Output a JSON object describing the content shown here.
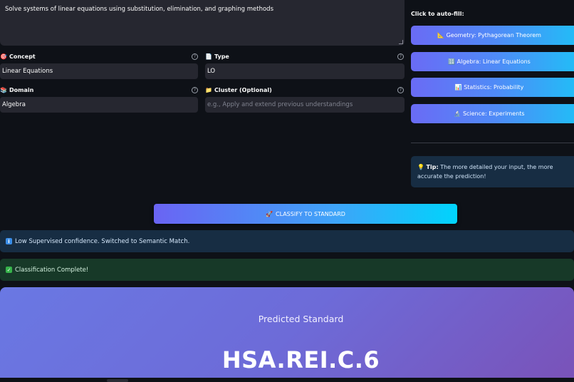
{
  "description_input": {
    "value": "Solve systems of linear equations using substitution, elimination, and graphing methods"
  },
  "fields": {
    "concept": {
      "icon": "concept-icon",
      "label": "Concept",
      "value": "Linear Equations"
    },
    "type": {
      "icon": "type-icon",
      "label": "Type",
      "value": "LO"
    },
    "domain": {
      "icon": "domain-icon",
      "label": "Domain",
      "value": "Algebra"
    },
    "cluster": {
      "icon": "folder-icon",
      "label": "Cluster (Optional)",
      "placeholder": "e.g., Apply and extend previous understandings"
    }
  },
  "help_icon_glyph": "?",
  "examples": {
    "autofill_label": "Click to auto-fill:",
    "buttons": [
      {
        "icon": "triangle-ruler-icon",
        "glyph": "📐",
        "label": "Geometry: Pythagorean Theorem"
      },
      {
        "icon": "numbers-icon",
        "glyph": "🔢",
        "label": "Algebra: Linear Equations"
      },
      {
        "icon": "bar-chart-icon",
        "glyph": "📊",
        "label": "Statistics: Probability"
      },
      {
        "icon": "microscope-icon",
        "glyph": "🔬",
        "label": "Science: Experiments"
      }
    ]
  },
  "tip": {
    "icon": "lightbulb-icon",
    "bold": "Tip:",
    "text": "The more detailed your input, the more accurate the prediction!"
  },
  "classify_button": {
    "icon": "rocket-icon",
    "label": "CLASSIFY TO STANDARD"
  },
  "alerts": {
    "info": {
      "icon": "info-icon",
      "text": "Low Supervised confidence. Switched to Semantic Match."
    },
    "success": {
      "icon": "check-icon",
      "text": "Classification Complete!"
    }
  },
  "result": {
    "subtitle": "Predicted Standard",
    "code": "HSA.REI.C.6"
  },
  "colors": {
    "background": "#0e1117",
    "input_bg": "#262730",
    "accent_start": "#6a6bf5",
    "accent_end": "#00d4fc",
    "info_bg": "#172d43",
    "success_bg": "#173928",
    "result_start": "#6a78e3",
    "result_end": "#7a52b8"
  }
}
